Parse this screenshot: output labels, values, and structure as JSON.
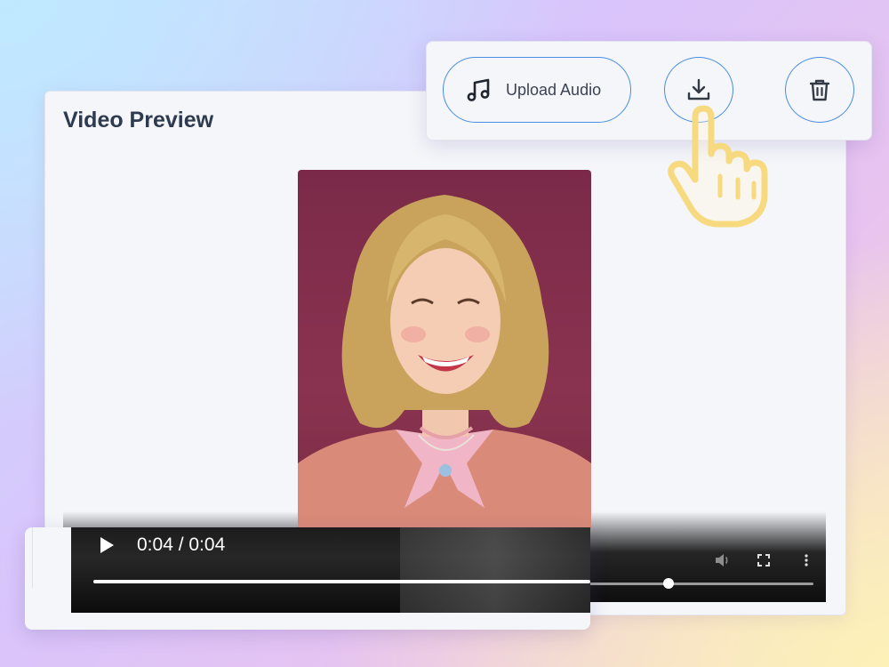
{
  "preview": {
    "title": "Video Preview"
  },
  "toolbar": {
    "upload_label": "Upload Audio",
    "upload_icon": "music-note-icon",
    "download_icon": "download-icon",
    "delete_icon": "trash-icon"
  },
  "player": {
    "time": "0:04 / 0:04",
    "progress": 1.0,
    "play_icon": "play-icon",
    "volume_icon": "volume-icon",
    "fullscreen_icon": "fullscreen-icon",
    "more_icon": "more-vertical-icon"
  },
  "colors": {
    "accent": "#4a8de0",
    "title": "#2d3a4f",
    "pointer": "#f7d980"
  }
}
